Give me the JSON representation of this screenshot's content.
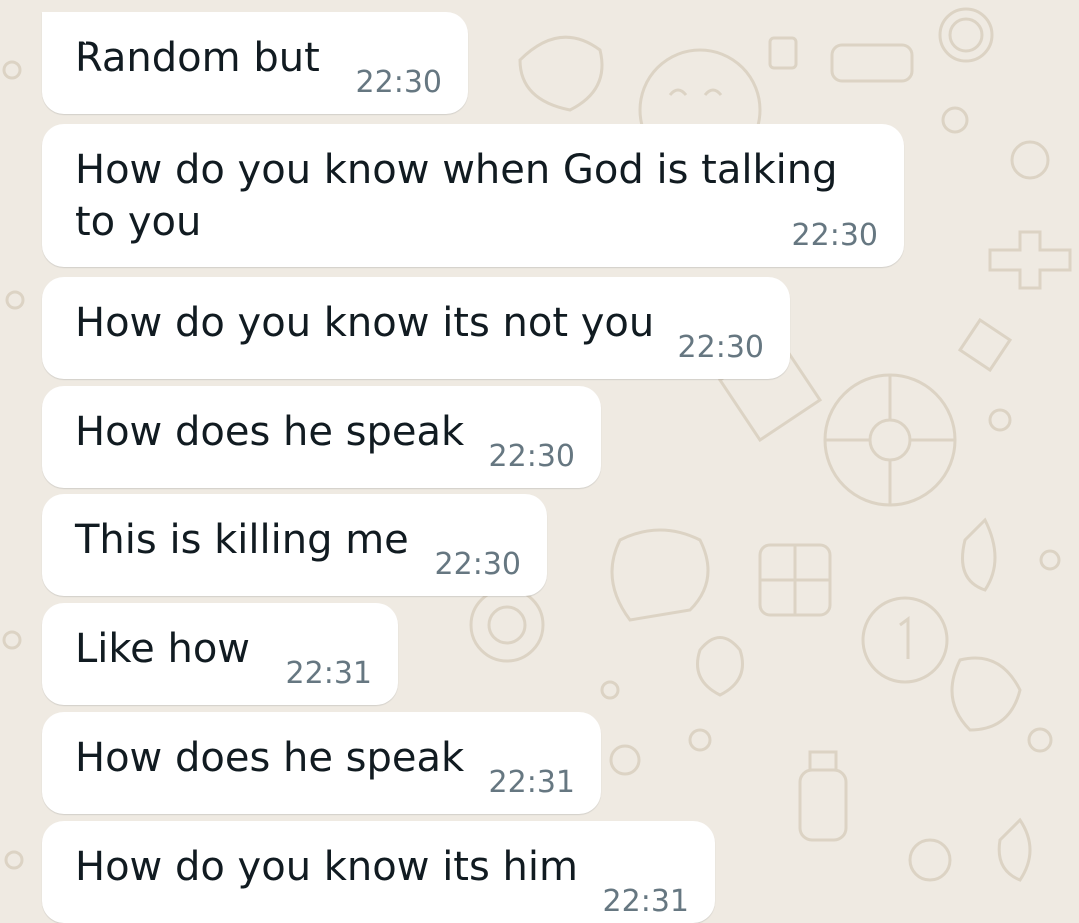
{
  "chat": {
    "messages": [
      {
        "text": "Random but",
        "time": "22:30"
      },
      {
        "text": "How do you know when God is talking to you",
        "time": "22:30"
      },
      {
        "text": "How do you know its not you",
        "time": "22:30"
      },
      {
        "text": "How does he speak",
        "time": "22:30"
      },
      {
        "text": "This is killing me",
        "time": "22:30"
      },
      {
        "text": "Like how",
        "time": "22:31"
      },
      {
        "text": "How does he speak",
        "time": "22:31"
      },
      {
        "text": "How do you know its him",
        "time": "22:31"
      }
    ]
  },
  "colors": {
    "background": "#efeae2",
    "bubble": "#ffffff",
    "text": "#111b21",
    "timestamp": "#667781"
  }
}
